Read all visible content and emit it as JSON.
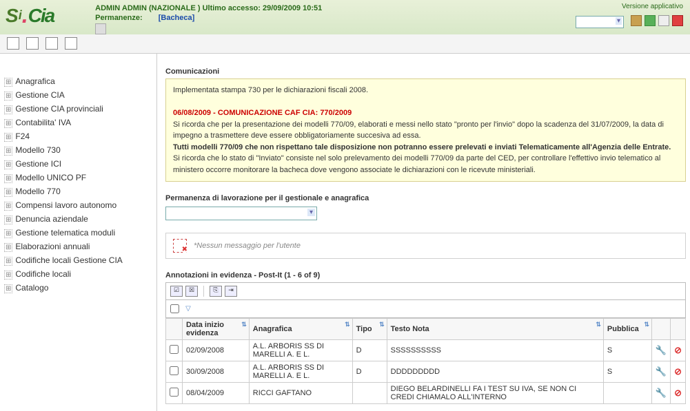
{
  "header": {
    "admin_line": "ADMIN ADMIN (NAZIONALE ) Ultimo accesso: 29/09/2009 10:51",
    "permanenze_label": "Permanenze:",
    "permanenze_value": "[Bacheca]",
    "version_label": "Versione applicativo"
  },
  "sidebar": {
    "items": [
      "Anagrafica",
      "Gestione CIA",
      "Gestione CIA provinciali",
      "Contabilita' IVA",
      "F24",
      "Modello 730",
      "Gestione ICI",
      "Modello UNICO PF",
      "Modello 770",
      "Compensi lavoro autonomo",
      "Denuncia aziendale",
      "Gestione telematica moduli",
      "Elaborazioni annuali",
      "Codifiche locali Gestione CIA",
      "Codifiche locali",
      "Catalogo"
    ]
  },
  "comm": {
    "title": "Comunicazioni",
    "line1": "Implementata stampa 730 per le dichiarazioni fiscali 2008.",
    "red": "06/08/2009 - COMUNICAZIONE CAF CIA: 770/2009",
    "p1": "Si ricorda che per la presentazione dei modelli 770/09, elaborati e messi nello stato \"pronto per l'invio\" dopo la scadenza del 31/07/2009, la data di impegno a trasmettere deve essere obbligatoriamente succesiva ad essa.",
    "bold": "Tutti modelli 770/09 che non rispettano tale disposizione non potranno essere prelevati e inviati Telematicamente all'Agenzia delle Entrate.",
    "p2": "Si ricorda che lo stato di \"Inviato\" consiste nel solo prelevamento dei modelli 770/09 da parte del CED, per controllare l'effettivo invio telematico al ministero occorre monitorare la bacheca dove vengono associate le dichiarazioni con le ricevute ministeriali."
  },
  "perm_work": {
    "title": "Permanenza di lavorazione per il gestionale e anagrafica"
  },
  "msg": {
    "text": "*Nessun messaggio per l'utente"
  },
  "grid": {
    "title": "Annotazioni in evidenza - Post-It (1 - 6 of 9)",
    "headers": {
      "data": "Data inizio evidenza",
      "anag": "Anagrafica",
      "tipo": "Tipo",
      "testo": "Testo Nota",
      "pubblica": "Pubblica"
    },
    "rows": [
      {
        "data": "02/09/2008",
        "anag": "A.L. ARBORIS SS DI MARELLI A. E L.",
        "tipo": "D",
        "testo": "SSSSSSSSSS",
        "pubblica": "S"
      },
      {
        "data": "30/09/2008",
        "anag": "A.L. ARBORIS SS DI MARELLI A. E L.",
        "tipo": "D",
        "testo": "DDDDDDDDD",
        "pubblica": "S"
      },
      {
        "data": "08/04/2009",
        "anag": "RICCI GAFTANO",
        "tipo": "",
        "testo": "DIEGO BELARDINELLI FA I TEST SU IVA, SE NON CI CREDI CHIAMALO   ALL'INTERNO",
        "pubblica": ""
      }
    ]
  }
}
